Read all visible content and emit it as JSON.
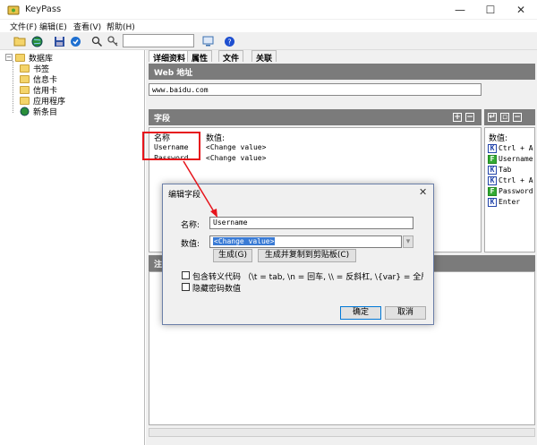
{
  "window": {
    "title": "KeyPass"
  },
  "menu": [
    "文件(F)",
    "编辑(E)",
    "查看(V)",
    "帮助(H)"
  ],
  "tree": {
    "root": "数据库",
    "items": [
      "书签",
      "信息卡",
      "信用卡",
      "应用程序",
      "新条目"
    ]
  },
  "tabs": [
    "详细资料",
    "属性",
    "文件",
    "关联"
  ],
  "url_section": {
    "header": "Web 地址",
    "value": "www.baidu.com"
  },
  "fields_section": {
    "header": "字段",
    "col_name": "名称",
    "col_value": "数值:",
    "rows": [
      {
        "name": "Username",
        "value": "<Change value>"
      },
      {
        "name": "Password",
        "value": "<Change value>"
      }
    ]
  },
  "sequence": {
    "label": "数值:",
    "rows": [
      {
        "badge": "K",
        "text": "Ctrl + A"
      },
      {
        "badge": "F",
        "text": "Username"
      },
      {
        "badge": "K",
        "text": "Tab"
      },
      {
        "badge": "K",
        "text": "Ctrl + A"
      },
      {
        "badge": "F",
        "text": "Password"
      },
      {
        "badge": "K",
        "text": "Enter"
      }
    ]
  },
  "notes_section": {
    "header": "注"
  },
  "dialog": {
    "title": "编辑字段",
    "name_label": "名称:",
    "name_value": "Username",
    "value_label": "数值:",
    "value_value": "<Change value>",
    "gen_button": "生成(G)",
    "gen_copy_button": "生成并复制到剪贴板(C)",
    "escape_label": "包含转义代码 （\\t = tab, \\n = 回车, \\\\ = 反斜杠, \\{var} = 全局变",
    "hide_label": "隐藏密码数值",
    "ok_button": "确定",
    "cancel_button": "取消"
  },
  "colors": {
    "annotation": "#e6141b",
    "section_header": "#7b7b7b"
  }
}
